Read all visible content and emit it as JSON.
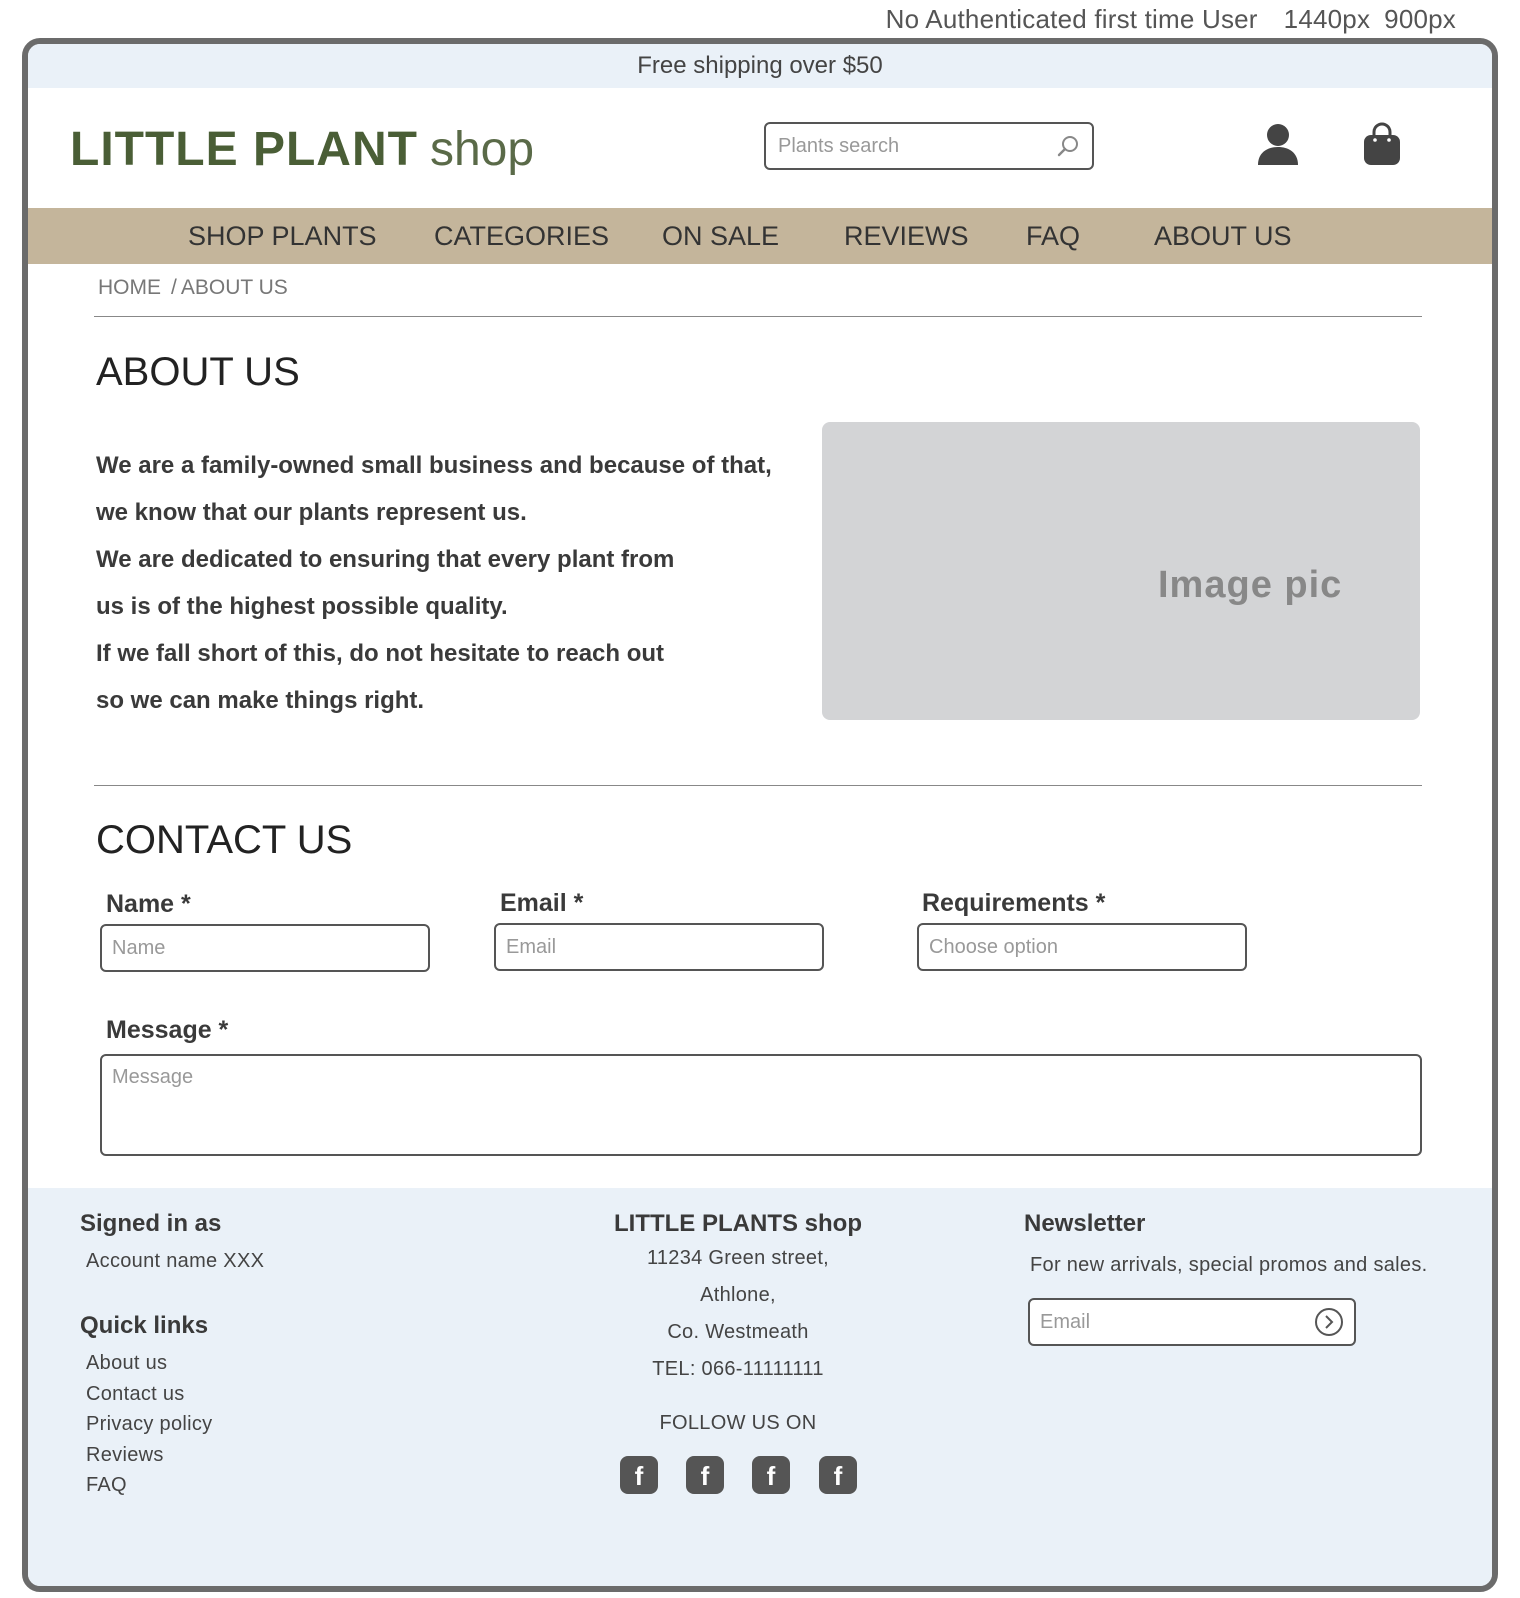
{
  "wireframe_meta": {
    "label": "No Authenticated first time User",
    "width_label": "1440px",
    "height_label": "900px"
  },
  "topbar": {
    "text": "Free shipping over $50"
  },
  "header": {
    "logo_bold": "LITTLE PLANT",
    "logo_light": "shop",
    "search_placeholder": "Plants search",
    "icons": {
      "search": "search-icon",
      "user": "user-icon",
      "bag": "shopping-bag-icon"
    }
  },
  "nav": {
    "items": [
      "SHOP PLANTS",
      "CATEGORIES",
      "ON SALE",
      "REVIEWS",
      "FAQ",
      "ABOUT US"
    ]
  },
  "breadcrumb": {
    "home": "HOME",
    "separator": "/",
    "current": "ABOUT US"
  },
  "about": {
    "title": "ABOUT US",
    "lines": [
      "We are a family-owned small business and because of that,",
      "we know that our plants represent us.",
      "We are dedicated to ensuring that every plant from",
      "us is of the highest possible quality.",
      "If we fall short of this, do not hesitate to reach out",
      "so we can make things right."
    ],
    "image_label": "Image pic"
  },
  "contact": {
    "title": "CONTACT US",
    "name_label": "Name *",
    "name_placeholder": "Name",
    "email_label": "Email *",
    "email_placeholder": "Email",
    "requirements_label": "Requirements *",
    "requirements_placeholder": "Choose option",
    "message_label": "Message *",
    "message_placeholder": "Message"
  },
  "footer": {
    "signed_in_heading": "Signed in as",
    "account_name": "Account name XXX",
    "quick_links_heading": "Quick links",
    "quick_links": [
      "About us",
      "Contact us",
      "Privacy policy",
      "Reviews",
      "FAQ"
    ],
    "shop_name": "LITTLE PLANTS shop",
    "address": [
      "11234 Green street,",
      "Athlone,",
      "Co. Westmeath",
      "TEL: 066-11111111"
    ],
    "follow_label": "FOLLOW US ON",
    "social_icons": [
      "facebook-icon",
      "facebook-icon",
      "facebook-icon",
      "facebook-icon"
    ],
    "social_glyph": "f",
    "newsletter_heading": "Newsletter",
    "newsletter_text": "For new arrivals, special promos and sales.",
    "newsletter_placeholder": "Email"
  },
  "colors": {
    "topbar_bg": "#eaf1f8",
    "nav_bg": "#c4b59b",
    "logo": "#4a5e36",
    "image_placeholder": "#d3d4d6",
    "footer_bg": "#eaf1f8"
  }
}
